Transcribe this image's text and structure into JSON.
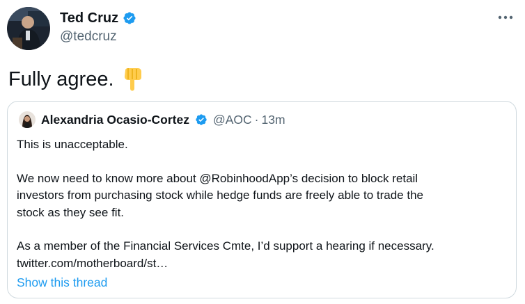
{
  "author": {
    "display_name": "Ted Cruz",
    "handle": "@tedcruz",
    "verified": true,
    "avatar_icon": "profile-photo"
  },
  "tweet": {
    "text": "Fully agree.",
    "emoji": "backhand-index-pointing-down"
  },
  "more_icon": "ellipsis-icon",
  "quoted_tweet": {
    "display_name": "Alexandria Ocasio-Cortez",
    "handle": "@AOC",
    "separator": "·",
    "time": "13m",
    "verified": true,
    "lines": {
      "l1": "This is unacceptable.",
      "l2": "We now need to know more about @RobinhoodApp’s decision to block retail",
      "l3": "investors from purchasing stock while hedge funds are freely able to trade the",
      "l4": "stock as they see fit.",
      "l5": "As a member of the Financial Services Cmte, I’d support a hearing if necessary.",
      "l6": "twitter.com/motherboard/st…"
    },
    "show_thread": "Show this thread"
  },
  "colors": {
    "verified_blue": "#1d9bf0",
    "link_blue": "#1d9bf0",
    "secondary_text": "#536471",
    "border": "#cfd9de"
  }
}
